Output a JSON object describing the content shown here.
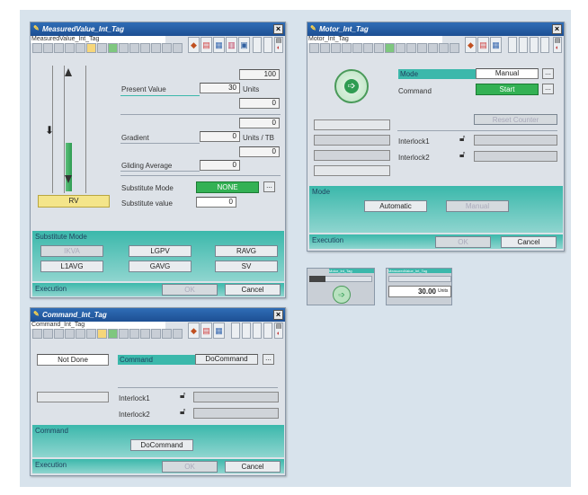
{
  "mv": {
    "title": "MeasuredValue_Int_Tag",
    "tag": "MeasuredValue_Int_Tag",
    "max_value": "100",
    "present_value_label": "Present Value",
    "present_value": "30",
    "units_label": "Units",
    "min_value": "0",
    "gradient_max": "0",
    "gradient_label": "Gradient",
    "gradient_value": "0",
    "gradient_units": "Units / TB",
    "gradient_min": "0",
    "gliding_label": "Gliding Average",
    "gliding_value": "0",
    "subst_mode_label": "Substitute Mode",
    "subst_mode_value": "NONE",
    "subst_value_label": "Substitute value",
    "subst_value": "0",
    "rv": "RV",
    "section": "Substitute Mode",
    "buttons": [
      "IKVA",
      "LGPV",
      "RAVG",
      "L1AVG",
      "GAVG",
      "SV"
    ],
    "exec_label": "Execution",
    "ok": "OK",
    "cancel": "Cancel",
    "dots": "..."
  },
  "motor": {
    "title": "Motor_Int_Tag",
    "tag": "Motor_Int_Tag",
    "mode_label": "Mode",
    "mode_value": "Manual",
    "command_label": "Command",
    "command_value": "Start",
    "reset_label": "Reset Counter",
    "interlock1": "Interlock1",
    "interlock2": "Interlock2",
    "section": "Mode",
    "automatic": "Automatic",
    "manual": "Manual",
    "exec_label": "Execution",
    "ok": "OK",
    "cancel": "Cancel",
    "dots": "..."
  },
  "cmd": {
    "title": "Command_Int_Tag",
    "tag": "Command_Int_Tag",
    "status": "Not Done",
    "command_label": "Command",
    "command_value": "DoCommand",
    "interlock1": "Interlock1",
    "interlock2": "Interlock2",
    "section": "Command",
    "docommand": "DoCommand",
    "exec_label": "Execution",
    "ok": "OK",
    "cancel": "Cancel",
    "dots": "..."
  },
  "mini": {
    "motor_tag": "Motor_Int_Tag",
    "mv_tag": "MeasuredValue_Int_Tag",
    "mv_value": "30.00",
    "mv_units": "Units"
  },
  "colors": {
    "accent": "#3bb8ab",
    "title": "#1d4f93",
    "green": "#33b154",
    "rv": "#f4e58a"
  },
  "icons": [
    "window-icon",
    "close-icon",
    "arrow-right-icon",
    "arrow-down-icon",
    "lock-icon",
    "check-icon"
  ]
}
